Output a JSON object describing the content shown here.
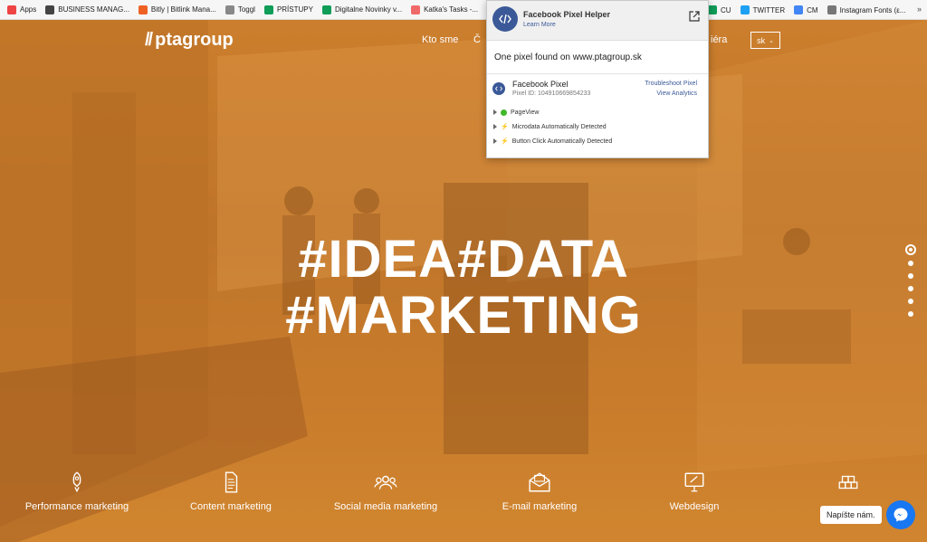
{
  "bookmarks": [
    {
      "label": "Apps",
      "color": "#e44"
    },
    {
      "label": "BUSINESS MANAG...",
      "color": "#444"
    },
    {
      "label": "Bitly | Bitlink Mana...",
      "color": "#ee6123"
    },
    {
      "label": "Toggl",
      "color": "#888"
    },
    {
      "label": "PRÍSTUPY",
      "color": "#0f9d58"
    },
    {
      "label": "Digitalne Novinky v...",
      "color": "#0f9d58"
    },
    {
      "label": "Katka's Tasks -...",
      "color": "#f06a6a"
    }
  ],
  "bookmarks_right": [
    {
      "label": "CU",
      "color": "#0f9d58"
    },
    {
      "label": "TWITTER",
      "color": "#1da1f2"
    },
    {
      "label": "CM",
      "color": "#4285f4"
    },
    {
      "label": "Instagram Fonts (ε...",
      "color": "#777"
    }
  ],
  "bookmarks_more": "»",
  "site": {
    "logo": "ptagroup",
    "nav": [
      "Kto sme",
      "Č",
      "iéra"
    ],
    "lang": "sk",
    "headline_1": "#IDEA#DATA",
    "headline_2": "#MARKETING",
    "slide_count": 6,
    "active_slide": 1,
    "services": [
      {
        "label": "Performance marketing",
        "icon": "rocket-icon"
      },
      {
        "label": "Content marketing",
        "icon": "document-icon"
      },
      {
        "label": "Social media marketing",
        "icon": "people-icon"
      },
      {
        "label": "E-mail marketing",
        "icon": "envelope-icon"
      },
      {
        "label": "Webdesign",
        "icon": "monitor-icon"
      },
      {
        "label": "",
        "icon": "cubes-icon"
      }
    ],
    "chat_prompt": "Napíšte nám."
  },
  "pixel_helper": {
    "title": "Facebook Pixel Helper",
    "learn_more": "Learn More",
    "found_text": "One pixel found on www.ptagroup.sk",
    "pixel_name": "Facebook Pixel",
    "pixel_id": "Pixel ID: 104910669854233",
    "troubleshoot": "Troubleshoot Pixel",
    "analytics": "View Analytics",
    "events": [
      {
        "label": "PageView",
        "status": "success"
      },
      {
        "label": "Microdata Automatically Detected",
        "status": "auto"
      },
      {
        "label": "Button Click Automatically Detected",
        "status": "auto"
      }
    ]
  }
}
